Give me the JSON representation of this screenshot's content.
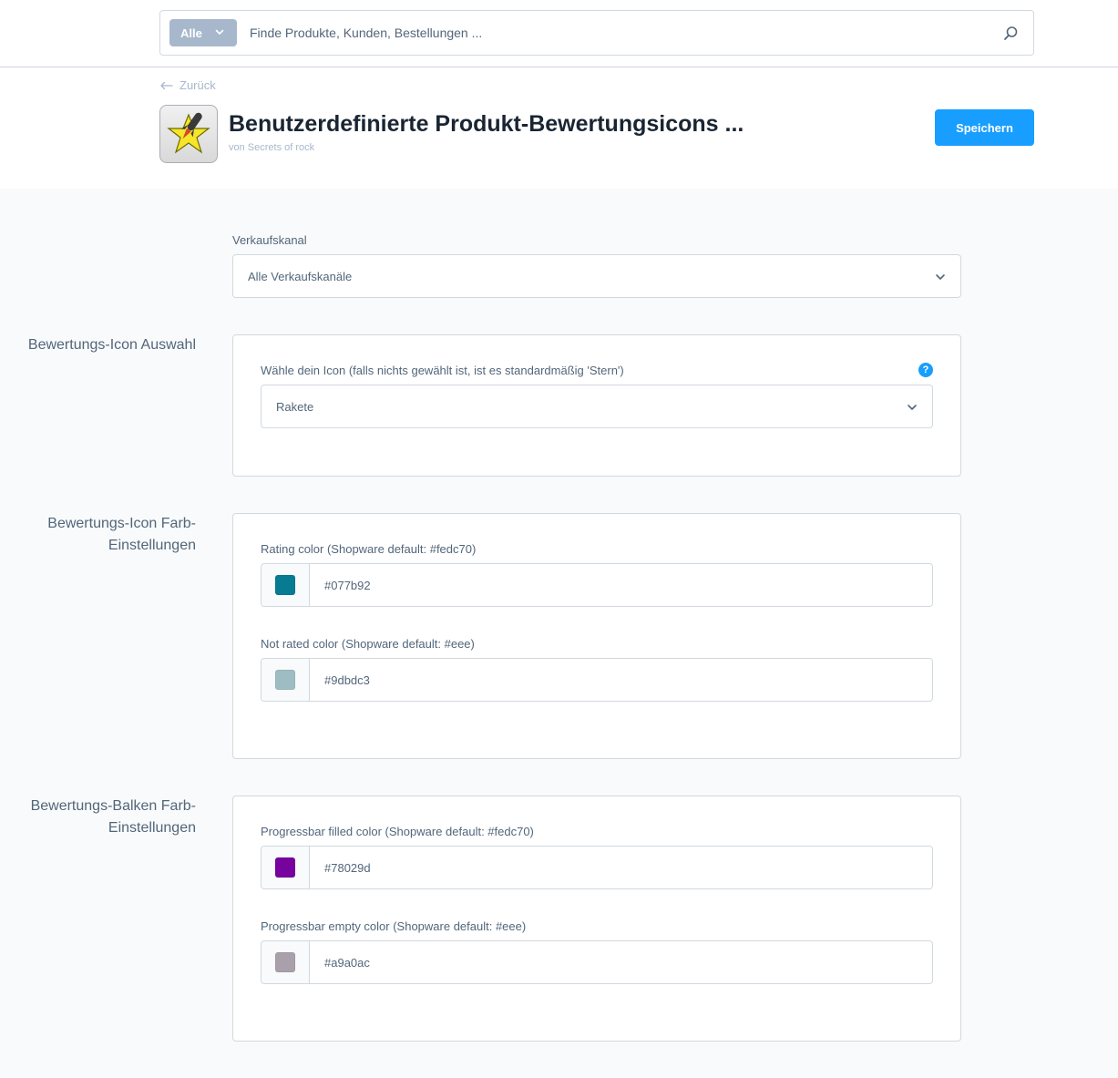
{
  "search": {
    "type_label": "Alle",
    "placeholder": "Finde Produkte, Kunden, Bestellungen ..."
  },
  "header": {
    "back_label": "Zurück",
    "title": "Benutzerdefinierte Produkt-Bewertungsicons ...",
    "subtitle": "von Secrets of rock",
    "save_label": "Speichern"
  },
  "sales_channel": {
    "label": "Verkaufskanal",
    "value": "Alle Verkaufskanäle"
  },
  "sections": {
    "icon_selection": {
      "title": "Bewertungs-Icon Auswahl",
      "field_label": "Wähle dein Icon (falls nichts gewählt ist, ist es standardmäßig 'Stern')",
      "field_value": "Rakete",
      "help": "?"
    },
    "icon_colors": {
      "title": "Bewertungs-Icon Farb-Einstellungen",
      "rating_label": "Rating color (Shopware default: #fedc70)",
      "rating_value": "#077b92",
      "not_rated_label": "Not rated color (Shopware default: #eee)",
      "not_rated_value": "#9dbdc3"
    },
    "bar_colors": {
      "title": "Bewertungs-Balken Farb-Einstellungen",
      "filled_label": "Progressbar filled color (Shopware default: #fedc70)",
      "filled_value": "#78029d",
      "empty_label": "Progressbar empty color (Shopware default: #eee)",
      "empty_value": "#a9a0ac"
    }
  },
  "colors": {
    "accent": "#189eff",
    "swatch_rating": "#077b92",
    "swatch_not_rated": "#9dbdc3",
    "swatch_filled": "#78029d",
    "swatch_empty": "#a9a0ac"
  }
}
